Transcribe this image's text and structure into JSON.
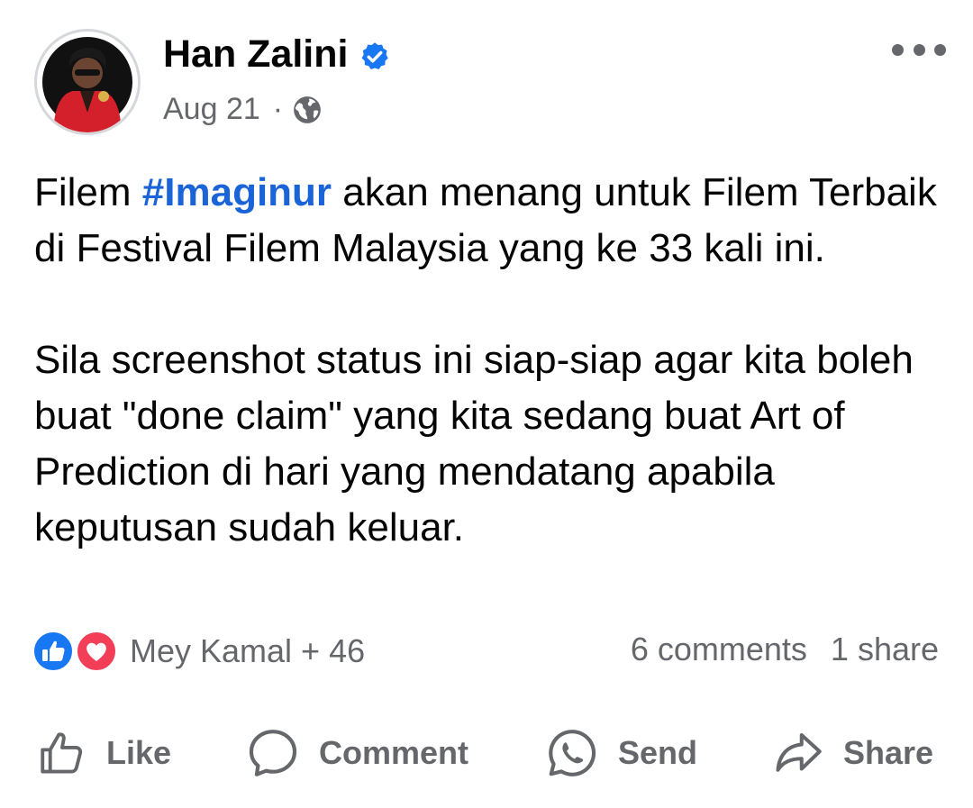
{
  "post": {
    "author": "Han Zalini",
    "date": "Aug 21",
    "separator": "·",
    "body_p1_before": "Filem ",
    "hashtag": "#Imaginur",
    "body_p1_after": " akan menang untuk Filem Terbaik di Festival Filem Malaysia yang ke 33 kali ini.",
    "body_p2": "Sila screenshot status ini siap-siap agar kita boleh buat \"done claim\" yang kita sedang buat Art of Prediction di hari yang mendatang apabila keputusan sudah keluar."
  },
  "stats": {
    "reactors": "Mey Kamal + 46",
    "comments": "6 comments",
    "shares": "1 share"
  },
  "actions": {
    "like": "Like",
    "comment": "Comment",
    "send": "Send",
    "share": "Share"
  },
  "icons": {
    "avatar": "profile-photo",
    "verified": "verified-badge-icon",
    "privacy": "globe-icon",
    "more": "more-options-icon",
    "reaction_like": "like-reaction-icon",
    "reaction_love": "love-reaction-icon"
  },
  "colors": {
    "accent": "#1a64d8",
    "secondary_text": "#65676b",
    "love": "#f33e58",
    "like": "#1877f2"
  }
}
